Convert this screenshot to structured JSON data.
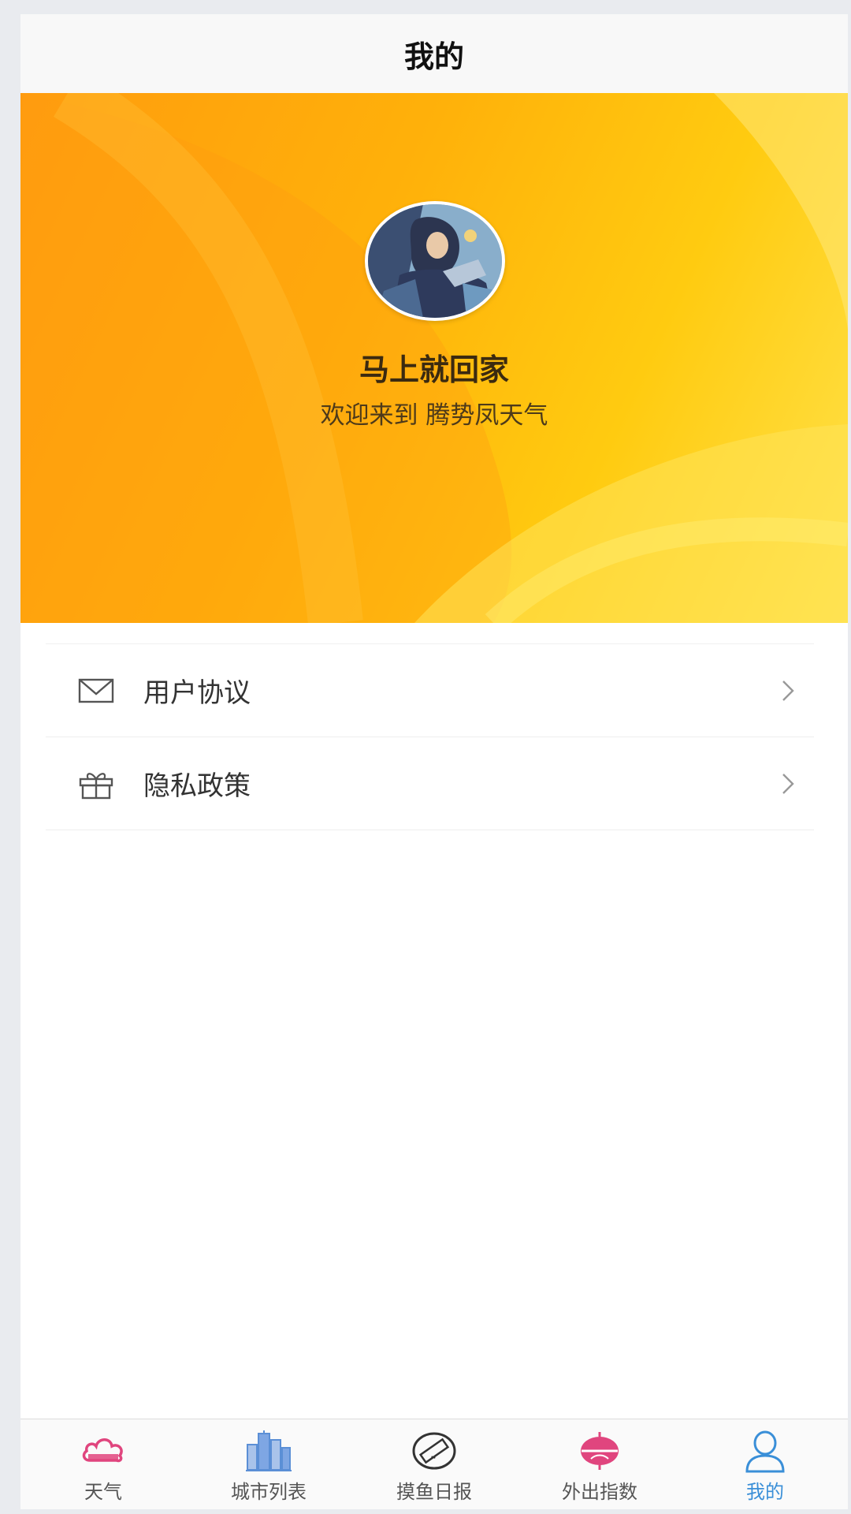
{
  "navbar": {
    "title": "我的"
  },
  "profile": {
    "name": "马上就回家",
    "welcome": "欢迎来到 腾势凤天气"
  },
  "menu": {
    "items": [
      {
        "label": "用户协议",
        "icon": "envelope-icon"
      },
      {
        "label": "隐私政策",
        "icon": "gift-icon"
      }
    ]
  },
  "tabbar": {
    "active": "我的",
    "tabs": [
      {
        "label": "天气",
        "icon": "cloud-icon"
      },
      {
        "label": "城市列表",
        "icon": "city-buildings-icon"
      },
      {
        "label": "摸鱼日报",
        "icon": "ruler-badge-icon"
      },
      {
        "label": "外出指数",
        "icon": "compass-icon"
      },
      {
        "label": "我的",
        "icon": "user-icon"
      }
    ]
  },
  "colors": {
    "banner_start": "#ff9c0e",
    "banner_end": "#ffe24a",
    "tab_active": "#3a8fd8",
    "weather_icon": "#e0457e",
    "city_icon": "#5b8fd6"
  }
}
